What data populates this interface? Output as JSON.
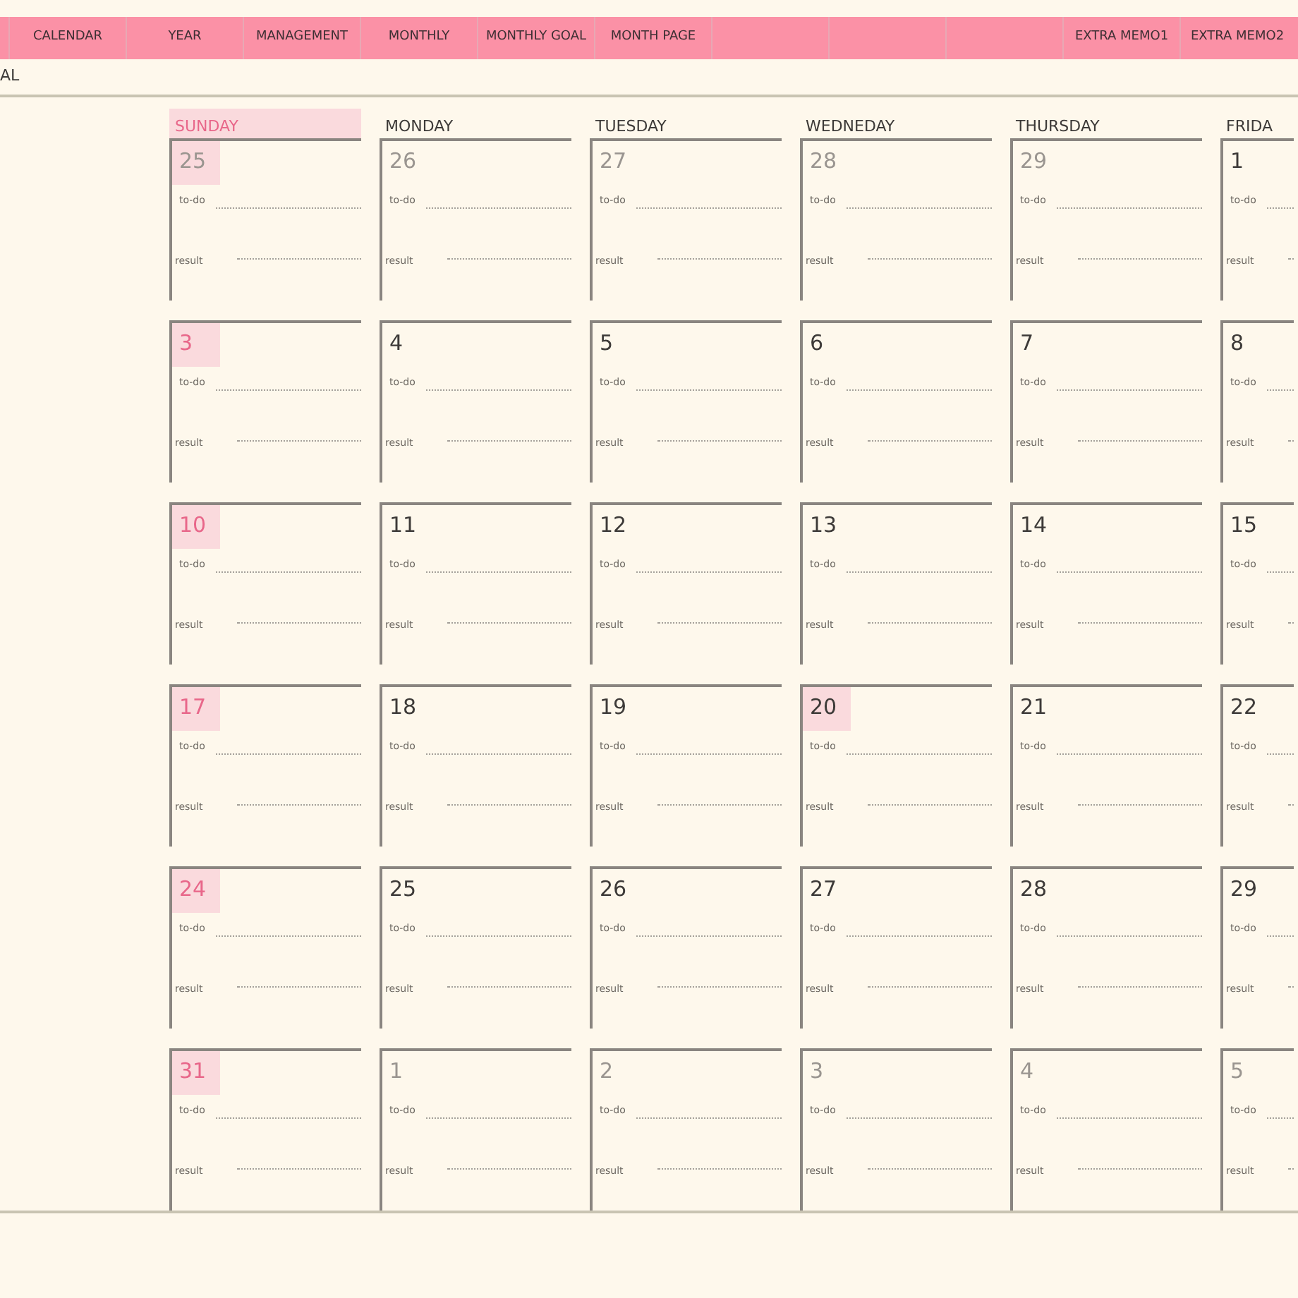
{
  "nav_tabs": [
    {
      "kind": "blank"
    },
    {
      "kind": "tab",
      "label": "CALENDAR"
    },
    {
      "kind": "tab",
      "label": "YEAR"
    },
    {
      "kind": "tab",
      "label": "MANAGEMENT"
    },
    {
      "kind": "tab",
      "label": "MONTHLY"
    },
    {
      "kind": "tab",
      "label": "MONTHLY GOAL"
    },
    {
      "kind": "tab",
      "label": "MONTH PAGE"
    },
    {
      "kind": "blank"
    },
    {
      "kind": "blank"
    },
    {
      "kind": "blank"
    },
    {
      "kind": "tab",
      "label": "EXTRA MEMO1"
    },
    {
      "kind": "tab",
      "label": "EXTRA MEMO2"
    }
  ],
  "subtitle": "AL",
  "calendar": {
    "weekdays": [
      {
        "label": "SUNDAY",
        "weekend": true
      },
      {
        "label": "MONDAY",
        "weekend": false
      },
      {
        "label": "TUESDAY",
        "weekend": false
      },
      {
        "label": "WEDNEDAY",
        "weekend": false
      },
      {
        "label": "THURSDAY",
        "weekend": false
      },
      {
        "label": "FRIDA",
        "weekend": false
      }
    ],
    "weeks": [
      [
        {
          "day": "25",
          "muted": true,
          "highlighted": true,
          "todo": "to-do",
          "result": "result"
        },
        {
          "day": "26",
          "muted": true,
          "highlighted": false,
          "todo": "to-do",
          "result": "result"
        },
        {
          "day": "27",
          "muted": true,
          "highlighted": false,
          "todo": "to-do",
          "result": "result"
        },
        {
          "day": "28",
          "muted": true,
          "highlighted": false,
          "todo": "to-do",
          "result": "result"
        },
        {
          "day": "29",
          "muted": true,
          "highlighted": false,
          "todo": "to-do",
          "result": "result"
        },
        {
          "day": "1",
          "muted": false,
          "highlighted": false,
          "todo": "to-do",
          "result": "result"
        }
      ],
      [
        {
          "day": "3",
          "muted": false,
          "highlighted": true,
          "todo": "to-do",
          "result": "result"
        },
        {
          "day": "4",
          "muted": false,
          "highlighted": false,
          "todo": "to-do",
          "result": "result"
        },
        {
          "day": "5",
          "muted": false,
          "highlighted": false,
          "todo": "to-do",
          "result": "result"
        },
        {
          "day": "6",
          "muted": false,
          "highlighted": false,
          "todo": "to-do",
          "result": "result"
        },
        {
          "day": "7",
          "muted": false,
          "highlighted": false,
          "todo": "to-do",
          "result": "result"
        },
        {
          "day": "8",
          "muted": false,
          "highlighted": false,
          "todo": "to-do",
          "result": "result"
        }
      ],
      [
        {
          "day": "10",
          "muted": false,
          "highlighted": true,
          "todo": "to-do",
          "result": "result"
        },
        {
          "day": "11",
          "muted": false,
          "highlighted": false,
          "todo": "to-do",
          "result": "result"
        },
        {
          "day": "12",
          "muted": false,
          "highlighted": false,
          "todo": "to-do",
          "result": "result"
        },
        {
          "day": "13",
          "muted": false,
          "highlighted": false,
          "todo": "to-do",
          "result": "result"
        },
        {
          "day": "14",
          "muted": false,
          "highlighted": false,
          "todo": "to-do",
          "result": "result"
        },
        {
          "day": "15",
          "muted": false,
          "highlighted": false,
          "todo": "to-do",
          "result": "result"
        }
      ],
      [
        {
          "day": "17",
          "muted": false,
          "highlighted": true,
          "todo": "to-do",
          "result": "result"
        },
        {
          "day": "18",
          "muted": false,
          "highlighted": false,
          "todo": "to-do",
          "result": "result"
        },
        {
          "day": "19",
          "muted": false,
          "highlighted": false,
          "todo": "to-do",
          "result": "result"
        },
        {
          "day": "20",
          "muted": false,
          "highlighted": true,
          "todo": "to-do",
          "result": "result"
        },
        {
          "day": "21",
          "muted": false,
          "highlighted": false,
          "todo": "to-do",
          "result": "result"
        },
        {
          "day": "22",
          "muted": false,
          "highlighted": false,
          "todo": "to-do",
          "result": "result"
        }
      ],
      [
        {
          "day": "24",
          "muted": false,
          "highlighted": true,
          "todo": "to-do",
          "result": "result"
        },
        {
          "day": "25",
          "muted": false,
          "highlighted": false,
          "todo": "to-do",
          "result": "result"
        },
        {
          "day": "26",
          "muted": false,
          "highlighted": false,
          "todo": "to-do",
          "result": "result"
        },
        {
          "day": "27",
          "muted": false,
          "highlighted": false,
          "todo": "to-do",
          "result": "result"
        },
        {
          "day": "28",
          "muted": false,
          "highlighted": false,
          "todo": "to-do",
          "result": "result"
        },
        {
          "day": "29",
          "muted": false,
          "highlighted": false,
          "todo": "to-do",
          "result": "result"
        }
      ],
      [
        {
          "day": "31",
          "muted": false,
          "highlighted": true,
          "todo": "to-do",
          "result": "result"
        },
        {
          "day": "1",
          "muted": true,
          "highlighted": false,
          "todo": "to-do",
          "result": "result"
        },
        {
          "day": "2",
          "muted": true,
          "highlighted": false,
          "todo": "to-do",
          "result": "result"
        },
        {
          "day": "3",
          "muted": true,
          "highlighted": false,
          "todo": "to-do",
          "result": "result"
        },
        {
          "day": "4",
          "muted": true,
          "highlighted": false,
          "todo": "to-do",
          "result": "result"
        },
        {
          "day": "5",
          "muted": true,
          "highlighted": false,
          "todo": "to-do",
          "result": "result"
        }
      ]
    ]
  }
}
